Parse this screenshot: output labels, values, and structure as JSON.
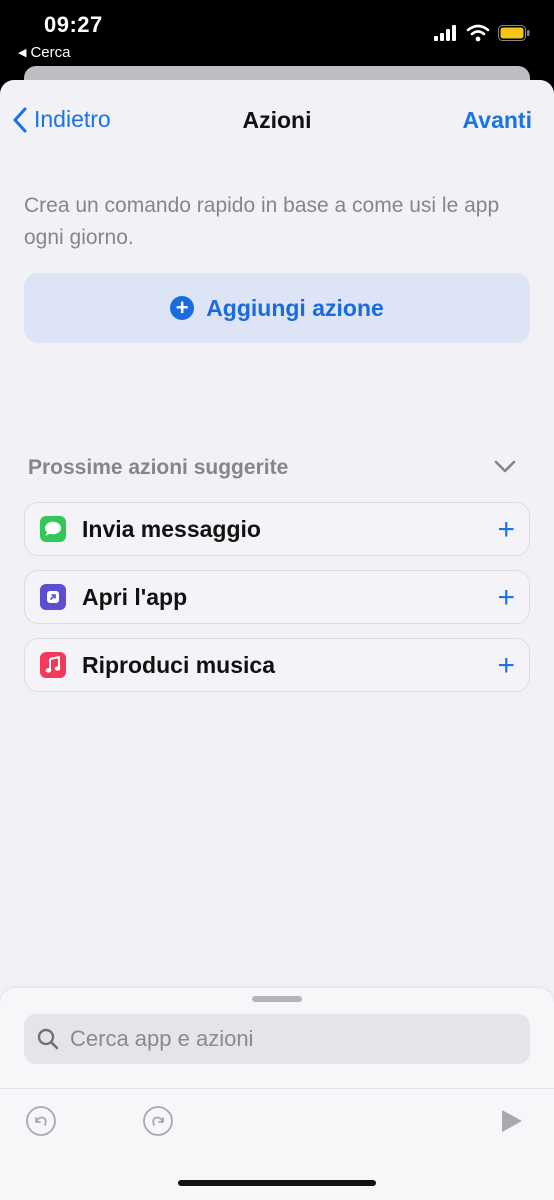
{
  "status": {
    "time": "09:27",
    "back_app": "Cerca"
  },
  "nav": {
    "back_label": "Indietro",
    "title": "Azioni",
    "next_label": "Avanti"
  },
  "description": "Crea un comando rapido in base a come usi le app ogni giorno.",
  "add_action_label": "Aggiungi azione",
  "suggestions": {
    "header": "Prossime azioni suggerite",
    "items": [
      {
        "label": "Invia messaggio",
        "icon": "messages-icon"
      },
      {
        "label": "Apri l'app",
        "icon": "open-app-icon"
      },
      {
        "label": "Riproduci musica",
        "icon": "music-icon"
      }
    ]
  },
  "search": {
    "placeholder": "Cerca app e azioni"
  },
  "colors": {
    "accent": "#1a73e8",
    "messages": "#33c75a",
    "shortcuts": "#5b4ed0",
    "music": "#f33a58"
  }
}
